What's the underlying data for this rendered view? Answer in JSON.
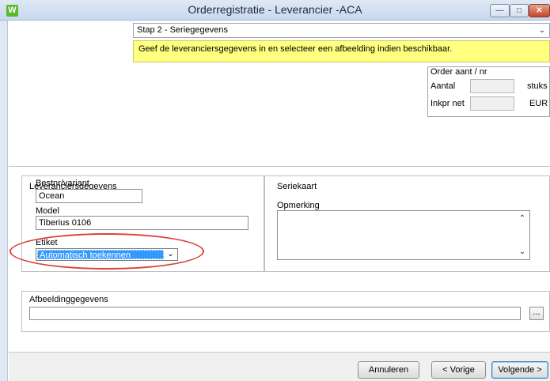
{
  "window": {
    "app_icon": "W",
    "title": "Orderregistratie - Leverancier -ACA",
    "minimize_glyph": "—",
    "maximize_glyph": "□",
    "close_glyph": "✕"
  },
  "step": {
    "selected": "Stap 2 - Seriegegevens",
    "chevron_glyph": "⌄"
  },
  "hint": "Geef de leveranciersgegevens in en selecteer een afbeelding indien beschikbaar.",
  "order": {
    "title": "Order aant / nr",
    "aantal_label": "Aantal",
    "aantal_value": "",
    "aantal_unit": "stuks",
    "inkpr_label": "Inkpr net",
    "inkpr_value": "",
    "inkpr_unit": "EUR"
  },
  "supplier": {
    "title": "Leveranciersgegevens",
    "bestnr_label": "Bestnr/variant",
    "bestnr_value": "Ocean",
    "model_label": "Model",
    "model_value": "Tiberius 0106",
    "etiket_label": "Etiket",
    "etiket_value": "Automatisch toekennen",
    "etiket_chevron": "⌄"
  },
  "seriekaart": {
    "title": "Seriekaart",
    "opmerking_label": "Opmerking",
    "opmerking_value": "",
    "scroll_up": "⌃",
    "scroll_down": "⌄"
  },
  "image": {
    "title": "Afbeeldinggegevens",
    "path_value": "",
    "browse_label": "..."
  },
  "footer": {
    "cancel_label": "Annuleren",
    "prev_label": "< Vorige",
    "next_label": "Volgende >"
  },
  "colors": {
    "hint_bg": "#ffff80",
    "highlight": "#d9433a",
    "selection": "#3399ff"
  }
}
